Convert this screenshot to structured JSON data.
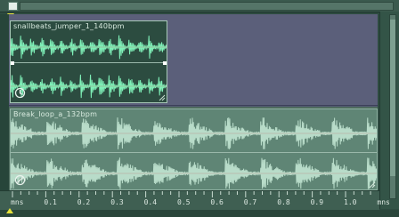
{
  "clips": [
    {
      "name": "snallbeats_jumper_1_140bpm"
    },
    {
      "name": "Break_loop_a_132bpm"
    }
  ],
  "ruler": {
    "ticks": [
      "mns",
      "0.1",
      "0.2",
      "0.3",
      "0.4",
      "0.5",
      "0.6",
      "0.7",
      "0.8",
      "0.9",
      "1.0",
      "mns"
    ]
  },
  "colors": {
    "accent_marker": "#e6e23a",
    "clip1_wave": "#7ff0b8",
    "clip2_wave": "#b8dcc9"
  }
}
